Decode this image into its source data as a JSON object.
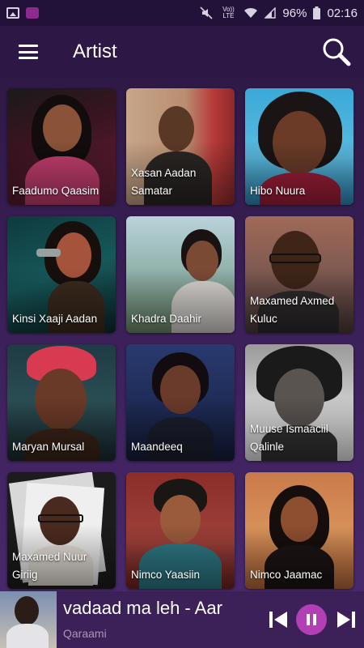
{
  "status_bar": {
    "battery": "96%",
    "time": "02:16",
    "network": "Vo)) LTE",
    "icons": [
      "image-icon",
      "app-notification-icon",
      "mute-icon",
      "volte-icon",
      "wifi-icon",
      "signal-icon",
      "battery-icon"
    ]
  },
  "app_bar": {
    "title": "Artist",
    "menu_icon": "hamburger-menu-icon",
    "search_icon": "search-icon"
  },
  "artists": [
    {
      "name": "Faadumo Qaasim"
    },
    {
      "name": "Xasan Aadan Samatar"
    },
    {
      "name": "Hibo Nuura"
    },
    {
      "name": "Kinsi Xaaji Aadan"
    },
    {
      "name": "Khadra Daahir"
    },
    {
      "name": "Maxamed Axmed Kuluc"
    },
    {
      "name": "Maryan Mursal"
    },
    {
      "name": "Maandeeq"
    },
    {
      "name": "Muuse Ismaaciil Qalinle"
    },
    {
      "name": "Maxamed Nuur Giriig"
    },
    {
      "name": "Nimco Yaasiin"
    },
    {
      "name": "Nimco Jaamac"
    }
  ],
  "player": {
    "title": "vadaad ma leh - Aar",
    "artist": "Qaraami",
    "controls": [
      "skip-previous-icon",
      "pause-icon",
      "skip-next-icon"
    ]
  },
  "colors": {
    "accent": "#b23fb4",
    "app_bar": "#2c1745",
    "background": "#3a1f57",
    "player_bar": "#3b2157"
  }
}
